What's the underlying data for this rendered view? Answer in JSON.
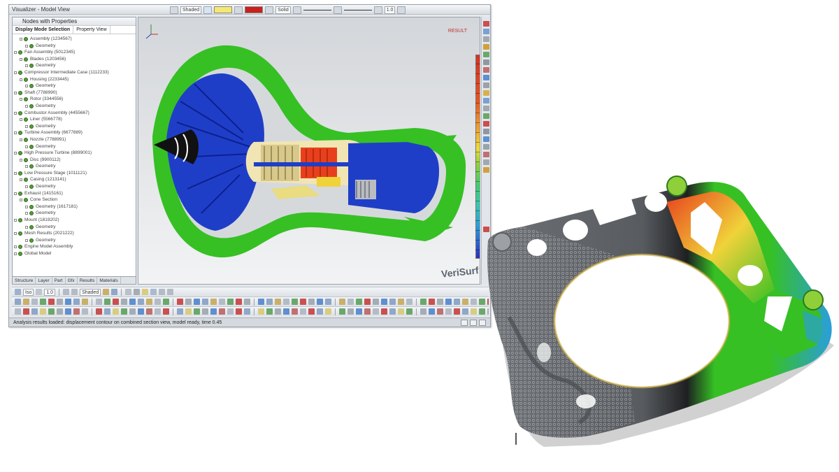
{
  "window": {
    "title": "Visualizer - Model View",
    "tree_header": "Nodes with Properties",
    "tree_tabs": [
      "Display Mode Selection",
      "Property View"
    ],
    "bottom_tabs": [
      "Structure",
      "Layer",
      "Part",
      "Gfx",
      "Results",
      "Materials"
    ],
    "status_text": "Analysis results loaded: displacement contour on combined section view, model ready, time 0.45",
    "command_combo": "Iso",
    "zoom_combo": "1.0",
    "display_combo": "Shaded",
    "color_field": "",
    "line_style": "Solid"
  },
  "tree": {
    "items": [
      {
        "label": "Assembly (1234567)",
        "level": 1
      },
      {
        "label": "Geometry",
        "level": 2
      },
      {
        "label": "Fan Assembly (5012345)",
        "level": 0
      },
      {
        "label": "Blades (1203456)",
        "level": 1
      },
      {
        "label": "Geometry",
        "level": 2
      },
      {
        "label": "Compressor Intermediate Case (1112233)",
        "level": 0
      },
      {
        "label": "Housing (2233445)",
        "level": 1
      },
      {
        "label": "Geometry",
        "level": 2
      },
      {
        "label": "Shaft (7788990)",
        "level": 0
      },
      {
        "label": "Rotor (3344556)",
        "level": 1
      },
      {
        "label": "Geometry",
        "level": 2
      },
      {
        "label": "Combustor Assembly (4455667)",
        "level": 0
      },
      {
        "label": "Liner (5566778)",
        "level": 1
      },
      {
        "label": "Geometry",
        "level": 2
      },
      {
        "label": "Turbine Assembly (6677889)",
        "level": 0
      },
      {
        "label": "Nozzle (7788991)",
        "level": 1
      },
      {
        "label": "Geometry",
        "level": 2
      },
      {
        "label": "High Pressure Turbine (8899001)",
        "level": 0
      },
      {
        "label": "Disc (9900112)",
        "level": 1
      },
      {
        "label": "Geometry",
        "level": 2
      },
      {
        "label": "Low Pressure Stage (1011121)",
        "level": 0
      },
      {
        "label": "Casing (1213141)",
        "level": 1
      },
      {
        "label": "Geometry",
        "level": 2
      },
      {
        "label": "Exhaust (1415161)",
        "level": 0
      },
      {
        "label": "Cone Section",
        "level": 1
      },
      {
        "label": "Geometry (1617181)",
        "level": 2
      },
      {
        "label": "Geometry",
        "level": 2
      },
      {
        "label": "Mount (1819202)",
        "level": 0
      },
      {
        "label": "Geometry",
        "level": 2
      },
      {
        "label": "Mesh Results (2021222)",
        "level": 0
      },
      {
        "label": "Geometry",
        "level": 2
      },
      {
        "label": "Engine Model Assembly",
        "level": 0
      },
      {
        "label": "Global Model",
        "level": 0
      }
    ]
  },
  "viewport": {
    "label": "RESULT",
    "watermark": "VeriSurf"
  },
  "colors": {
    "fem_green": "#38c02a",
    "fem_blue": "#1f3ec8",
    "fem_red": "#e8401c",
    "fem_yellow": "#f0d23a",
    "mesh_gray": "#6e7276"
  },
  "icons": [
    "rotate-icon",
    "zoom-icon",
    "pan-icon",
    "fit-icon",
    "section-icon",
    "measure-icon",
    "settings-icon"
  ]
}
